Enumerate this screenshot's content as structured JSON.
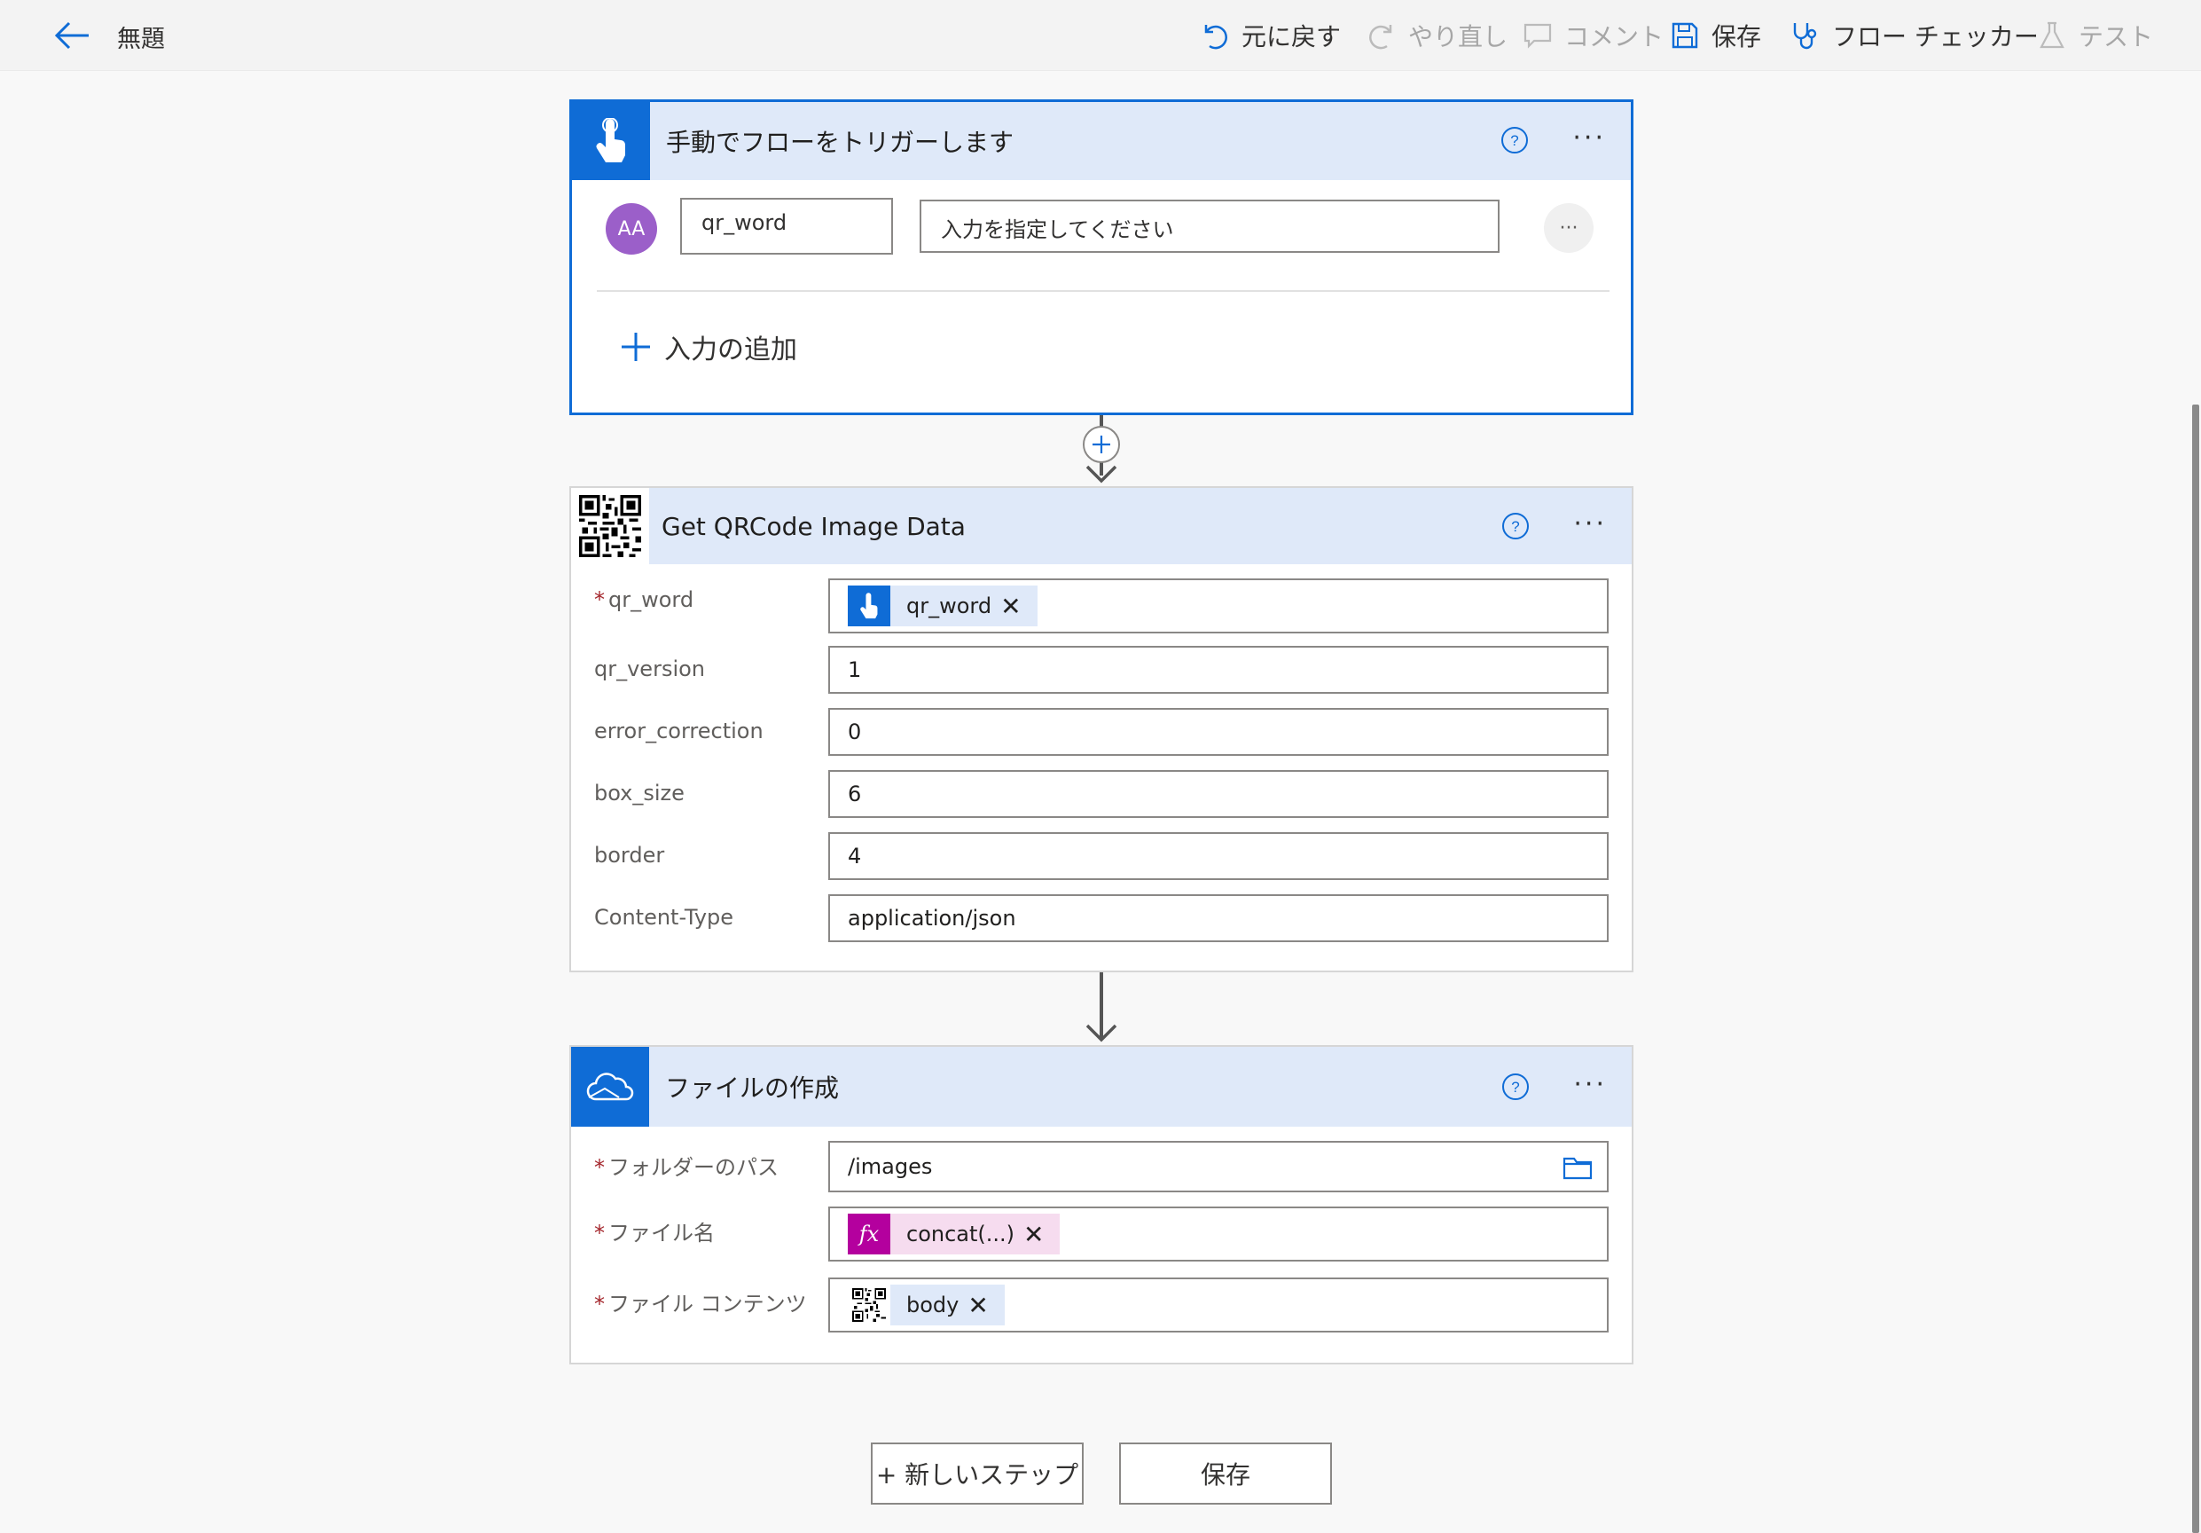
{
  "app": {
    "title": "無題"
  },
  "toolbar": {
    "undo": "元に戻す",
    "redo": "やり直し",
    "comment": "コメント",
    "save": "保存",
    "checker": "フロー チェッカー",
    "test": "テスト"
  },
  "colors": {
    "accent": "#0f6cd6",
    "header_bg": "#dfe9f9",
    "fx_token": "#b4009e",
    "required": "#a4262c"
  },
  "trigger": {
    "title": "手動でフローをトリガーします",
    "input_name": "qr_word",
    "input_placeholder": "入力を指定してください",
    "avatar_text": "AA",
    "add_input": "入力の追加",
    "icon": "hand-touch-icon"
  },
  "qr_action": {
    "title": "Get QRCode Image Data",
    "icon": "qr-code-icon",
    "fields": [
      {
        "label": "qr_word",
        "required": true,
        "token": "qr_word"
      },
      {
        "label": "qr_version",
        "value": "1"
      },
      {
        "label": "error_correction",
        "value": "0"
      },
      {
        "label": "box_size",
        "value": "6"
      },
      {
        "label": "border",
        "value": "4"
      },
      {
        "label": "Content-Type",
        "value": "application/json"
      }
    ]
  },
  "create_file": {
    "title": "ファイルの作成",
    "icon": "onedrive-cloud-icon",
    "fields": [
      {
        "label": "フォルダーのパス",
        "required": true,
        "value": "/images"
      },
      {
        "label": "ファイル名",
        "required": true,
        "token": "concat(...)",
        "token_icon": "fx"
      },
      {
        "label": "ファイル コンテンツ",
        "required": true,
        "token": "body"
      }
    ]
  },
  "footer": {
    "new_step": "+ 新しいステップ",
    "save": "保存"
  }
}
